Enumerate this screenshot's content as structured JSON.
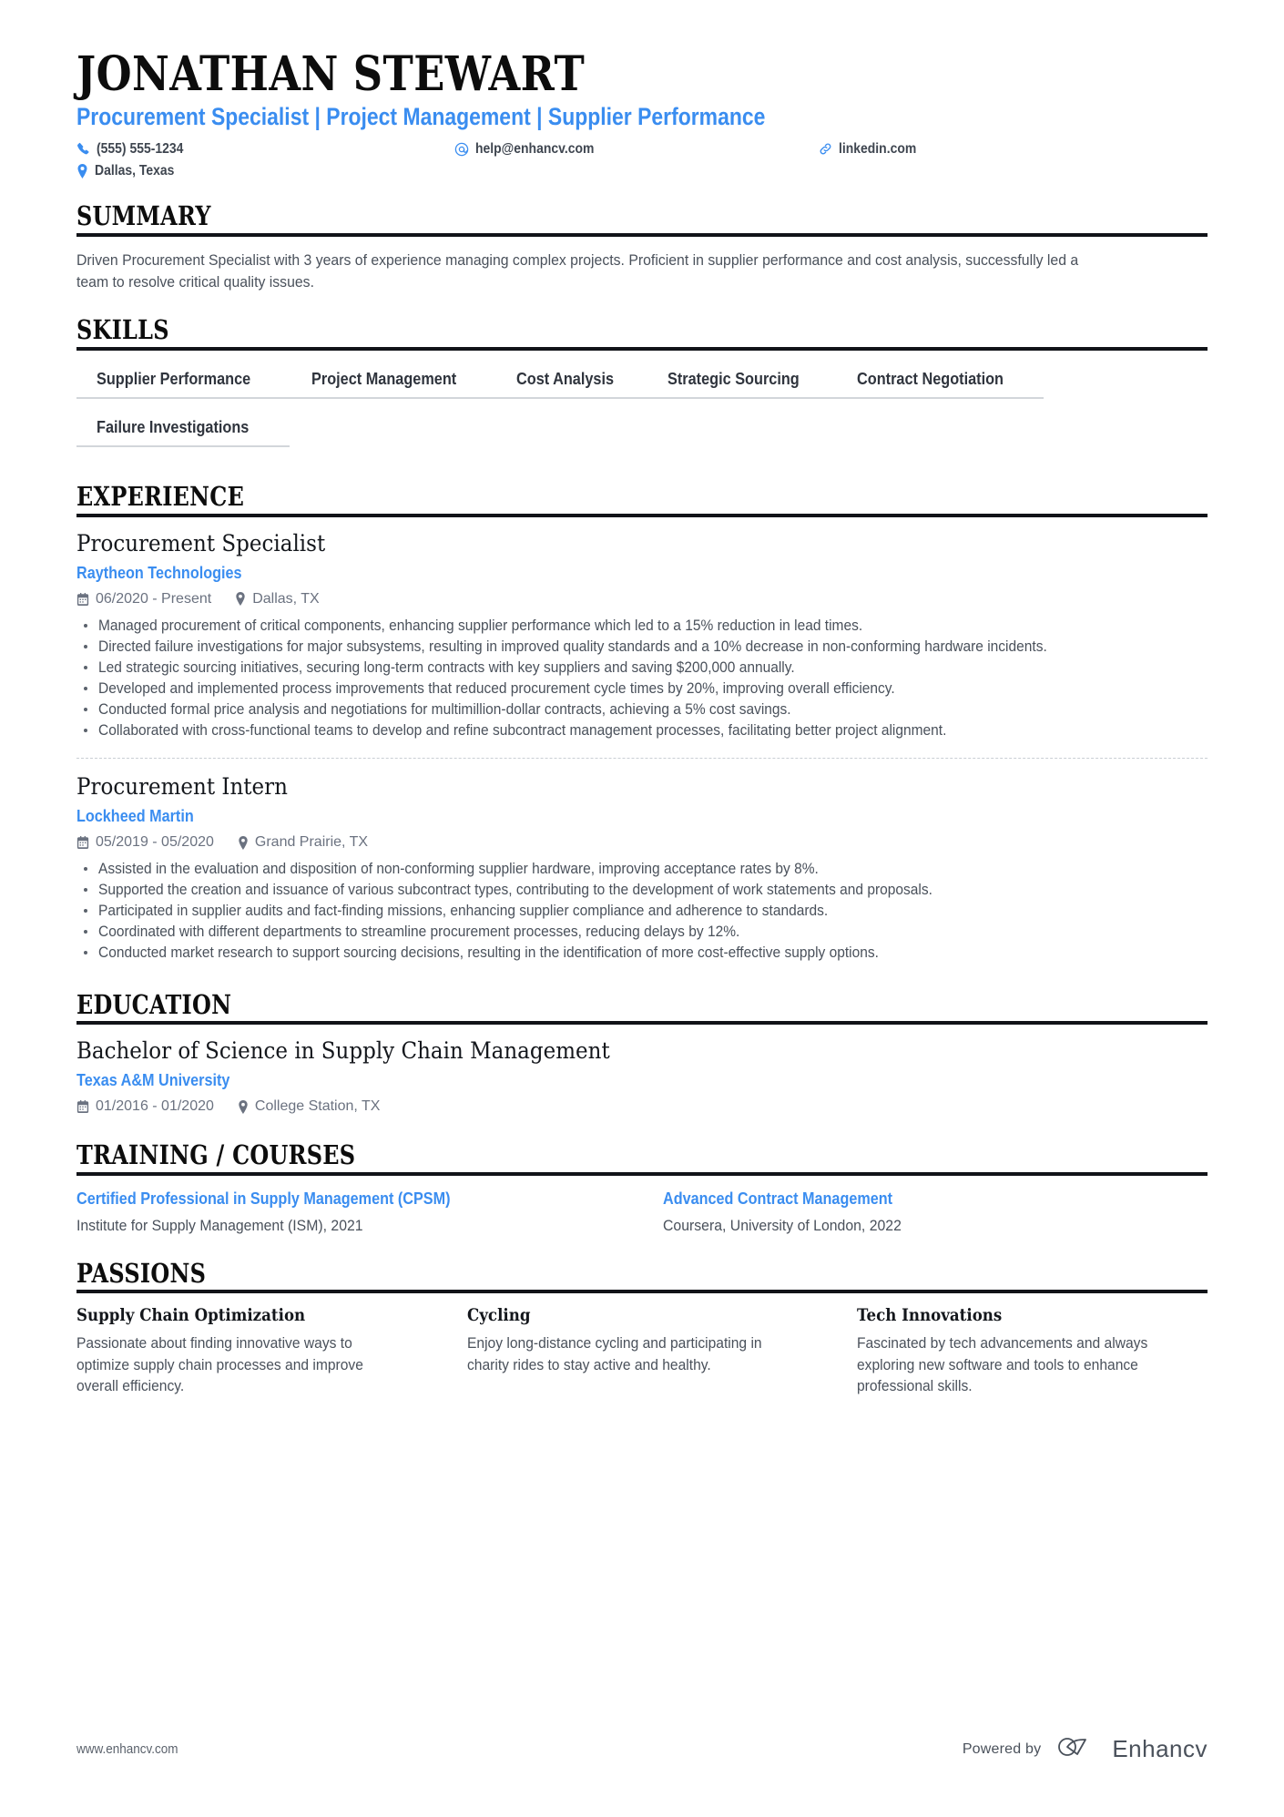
{
  "theme": {
    "accent": "#3a8df0",
    "ink": "#0d0d0d",
    "body": "#4a515b",
    "rule": "#111318"
  },
  "header": {
    "name": "JONATHAN STEWART",
    "headline": "Procurement Specialist | Project Management | Supplier Performance",
    "contacts": [
      {
        "icon": "phone-icon",
        "text": "(555) 555-1234"
      },
      {
        "icon": "email-icon",
        "text": "help@enhancv.com"
      },
      {
        "icon": "link-icon",
        "text": "linkedin.com"
      },
      {
        "icon": "location-icon",
        "text": "Dallas, Texas"
      }
    ]
  },
  "summary": {
    "heading": "SUMMARY",
    "text": "Driven Procurement Specialist with 3 years of experience managing complex projects. Proficient in supplier performance and cost analysis, successfully led a team to resolve critical quality issues."
  },
  "skills": {
    "heading": "SKILLS",
    "items": [
      "Supplier Performance",
      "Project Management",
      "Cost Analysis",
      "Strategic Sourcing",
      "Contract Negotiation",
      "Failure Investigations"
    ]
  },
  "experience": {
    "heading": "EXPERIENCE",
    "entries": [
      {
        "title": "Procurement Specialist",
        "company": "Raytheon Technologies",
        "dates": "06/2020 - Present",
        "location": "Dallas, TX",
        "bullets": [
          "Managed procurement of critical components, enhancing supplier performance which led to a 15% reduction in lead times.",
          "Directed failure investigations for major subsystems, resulting in improved quality standards and a 10% decrease in non-conforming hardware incidents.",
          "Led strategic sourcing initiatives, securing long-term contracts with key suppliers and saving $200,000 annually.",
          "Developed and implemented process improvements that reduced procurement cycle times by 20%, improving overall efficiency.",
          "Conducted formal price analysis and negotiations for multimillion-dollar contracts, achieving a 5% cost savings.",
          "Collaborated with cross-functional teams to develop and refine subcontract management processes, facilitating better project alignment."
        ]
      },
      {
        "title": "Procurement Intern",
        "company": "Lockheed Martin",
        "dates": "05/2019 - 05/2020",
        "location": "Grand Prairie, TX",
        "bullets": [
          "Assisted in the evaluation and disposition of non-conforming supplier hardware, improving acceptance rates by 8%.",
          "Supported the creation and issuance of various subcontract types, contributing to the development of work statements and proposals.",
          "Participated in supplier audits and fact-finding missions, enhancing supplier compliance and adherence to standards.",
          "Coordinated with different departments to streamline procurement processes, reducing delays by 12%.",
          "Conducted market research to support sourcing decisions, resulting in the identification of more cost-effective supply options."
        ]
      }
    ]
  },
  "education": {
    "heading": "EDUCATION",
    "entries": [
      {
        "degree": "Bachelor of Science in Supply Chain Management",
        "school": "Texas A&M University",
        "dates": "01/2016 - 01/2020",
        "location": "College Station, TX"
      }
    ]
  },
  "training": {
    "heading": "TRAINING / COURSES",
    "courses": [
      {
        "title": "Certified Professional in Supply Management (CPSM)",
        "subtitle": "Institute for Supply Management (ISM), 2021"
      },
      {
        "title": "Advanced Contract Management",
        "subtitle": "Coursera, University of London, 2022"
      }
    ]
  },
  "passions": {
    "heading": "PASSIONS",
    "items": [
      {
        "title": "Supply Chain Optimization",
        "text": "Passionate about finding innovative ways to optimize supply chain processes and improve overall efficiency."
      },
      {
        "title": "Cycling",
        "text": "Enjoy long-distance cycling and participating in charity rides to stay active and healthy."
      },
      {
        "title": "Tech Innovations",
        "text": "Fascinated by tech advancements and always exploring new software and tools to enhance professional skills."
      }
    ]
  },
  "footer": {
    "url": "www.enhancv.com",
    "powered_label": "Powered by",
    "brand": "Enhancv"
  }
}
